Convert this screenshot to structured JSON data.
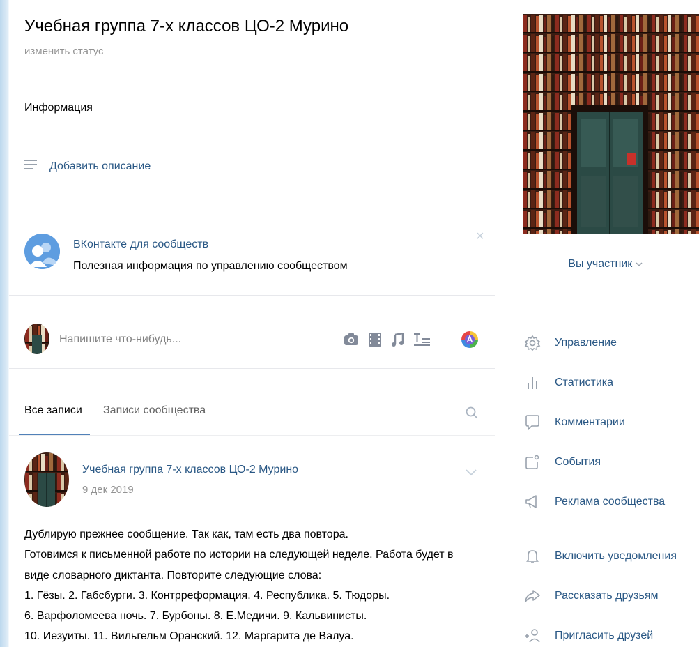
{
  "group": {
    "title": "Учебная группа 7-х классов ЦО-2 Мурино",
    "status_link": "изменить статус",
    "info_label": "Информация",
    "add_description": "Добавить описание"
  },
  "promo": {
    "title": "ВКонтакте для сообществ",
    "text": "Полезная информация по управлению сообществом",
    "close": "×"
  },
  "composer": {
    "placeholder": "Напишите что-нибудь...",
    "tools": [
      "camera-icon",
      "video-icon",
      "music-icon",
      "text-format-icon",
      "poster-icon"
    ]
  },
  "tabs": [
    {
      "label": "Все записи",
      "active": true
    },
    {
      "label": "Записи сообщества",
      "active": false
    }
  ],
  "post": {
    "author": "Учебная группа 7-х классов ЦО-2 Мурино",
    "date": "9 дек 2019",
    "lines": [
      "Дублирую прежнее сообщение. Так как, там есть два повтора.",
      "Готовимся к письменной работе по истории на следующей неделе. Работа будет в",
      "виде словарного диктанта. Повторите следующие слова:",
      "1. Гёзы. 2. Габсбурги. 3. Контрреформация. 4. Республика. 5. Тюдоры.",
      "6. Варфоломеева ночь. 7. Бурбоны. 8. Е.Медичи. 9. Кальвинисты.",
      "10. Иезуиты. 11. Вильгельм Оранский. 12. Маргарита де Валуа."
    ]
  },
  "sidebar": {
    "membership": "Вы участник",
    "menu": [
      {
        "label": "Управление",
        "icon": "gear-icon"
      },
      {
        "label": "Статистика",
        "icon": "statistics-icon"
      },
      {
        "label": "Комментарии",
        "icon": "comment-icon"
      },
      {
        "label": "События",
        "icon": "events-icon"
      },
      {
        "label": "Реклама сообщества",
        "icon": "megaphone-icon"
      },
      {
        "label": "Включить уведомления",
        "icon": "bell-icon"
      },
      {
        "label": "Рассказать друзьям",
        "icon": "share-icon"
      },
      {
        "label": "Пригласить друзей",
        "icon": "invite-friends-icon"
      }
    ]
  },
  "colors": {
    "link": "#2a5885",
    "accent": "#5181b8",
    "icon": "#99a2ad",
    "muted": "#939393"
  }
}
